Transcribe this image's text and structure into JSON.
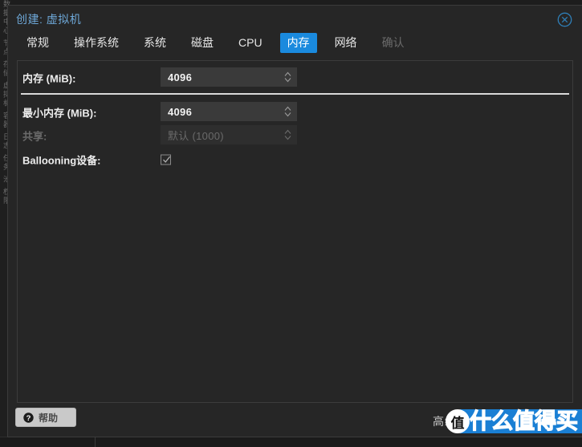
{
  "window": {
    "title": "创建: 虚拟机",
    "close_icon": "close-circle-icon"
  },
  "tabs": [
    {
      "label": "常规",
      "state": "normal"
    },
    {
      "label": "操作系统",
      "state": "normal"
    },
    {
      "label": "系统",
      "state": "normal"
    },
    {
      "label": "磁盘",
      "state": "normal"
    },
    {
      "label": "CPU",
      "state": "normal"
    },
    {
      "label": "内存",
      "state": "active"
    },
    {
      "label": "网络",
      "state": "normal"
    },
    {
      "label": "确认",
      "state": "disabled"
    }
  ],
  "form": {
    "memory": {
      "label": "内存 (MiB):",
      "value": "4096",
      "placeholder": "",
      "disabled": false
    },
    "min_memory": {
      "label": "最小内存 (MiB):",
      "value": "4096",
      "placeholder": "",
      "disabled": false
    },
    "shares": {
      "label": "共享:",
      "value": "",
      "placeholder": "默认 (1000)",
      "disabled": true
    },
    "ballooning": {
      "label": "Ballooning设备:",
      "checked": true
    }
  },
  "footer": {
    "help_label": "帮助",
    "help_icon": "question-circle-icon",
    "advanced_label": "高级"
  },
  "watermark": {
    "logo_char": "值",
    "banner_text": "什么值得买"
  },
  "colors": {
    "accent_blue": "#1a8ade",
    "title_blue": "#6ea8d8",
    "dialog_bg": "#262626",
    "input_bg": "#3a3a3a",
    "separator": "#d9d9d9",
    "watermark_blue": "#1a7fd4"
  }
}
